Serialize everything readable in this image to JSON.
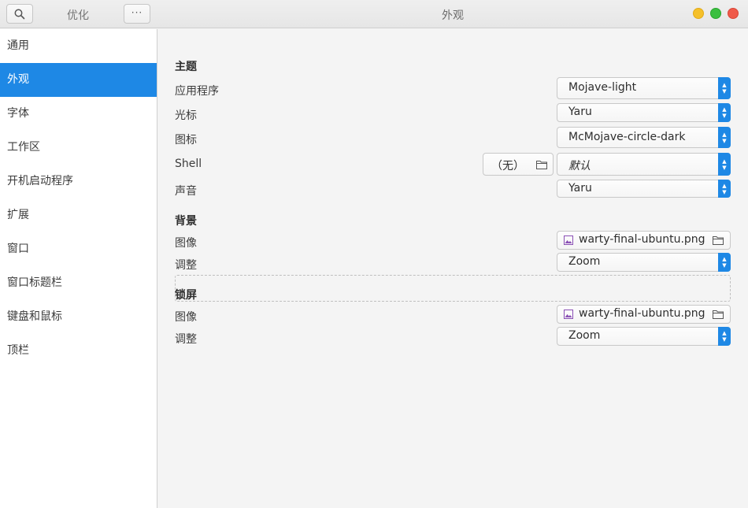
{
  "header": {
    "left_title": "优化",
    "title": "外观",
    "search_icon": "search-icon",
    "more_label": "···"
  },
  "sidebar": {
    "items": [
      {
        "label": "通用"
      },
      {
        "label": "外观",
        "selected": true
      },
      {
        "label": "字体"
      },
      {
        "label": "工作区"
      },
      {
        "label": "开机启动程序"
      },
      {
        "label": "扩展"
      },
      {
        "label": "窗口"
      },
      {
        "label": "窗口标题栏"
      },
      {
        "label": "键盘和鼠标"
      },
      {
        "label": "顶栏"
      }
    ]
  },
  "themes": {
    "title": "主题",
    "applications": {
      "label": "应用程序",
      "value": "Mojave-light"
    },
    "cursor": {
      "label": "光标",
      "value": "Yaru"
    },
    "icons": {
      "label": "图标",
      "value": "McMojave-circle-dark"
    },
    "shell": {
      "label": "Shell",
      "file_value": "（无）",
      "value": "默认"
    },
    "sound": {
      "label": "声音",
      "value": "Yaru"
    }
  },
  "background": {
    "title": "背景",
    "image": {
      "label": "图像",
      "value": "warty-final-ubuntu.png"
    },
    "adjustment": {
      "label": "调整",
      "value": "Zoom"
    }
  },
  "lock_screen": {
    "title": "锁屏",
    "image": {
      "label": "图像",
      "value": "warty-final-ubuntu.png"
    },
    "adjustment": {
      "label": "调整",
      "value": "Zoom"
    }
  },
  "colors": {
    "accent": "#1e88e5",
    "window_minimize": "#f5c02a",
    "window_maximize": "#3bbf40",
    "window_close": "#ef5a4a"
  }
}
